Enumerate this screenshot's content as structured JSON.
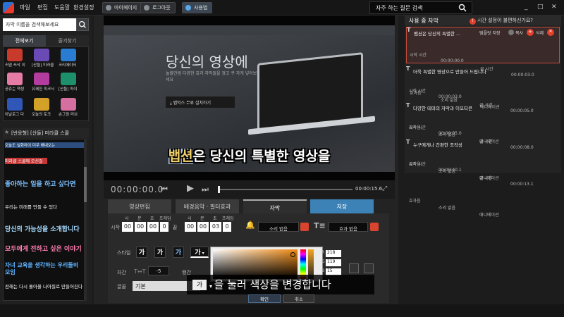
{
  "menubar": {
    "items": [
      "파일",
      "편집",
      "도움말",
      "환경설정"
    ],
    "buttons": {
      "mypage": "마이페이지",
      "logout": "로그아웃",
      "usage": "사용법"
    },
    "faq_label": "자주 하는 질문 검색",
    "window_controls": [
      "_",
      "□",
      "✕"
    ]
  },
  "left": {
    "search_placeholder": "자막 이름을 검색해보세요",
    "tabs": [
      "전체보기",
      "즐겨찾기"
    ],
    "grid": [
      {
        "caption": "귀엽 쓰삭 이",
        "badge": "반응형",
        "color": "#c83b2c"
      },
      {
        "caption": "[산들] 미라클",
        "badge": "반응형",
        "color": "#6a4bb6"
      },
      {
        "caption": "크리에이터",
        "badge": "반응형",
        "color": "#2a7cd1"
      },
      {
        "caption": "공쥬는 책생",
        "badge": "반응형",
        "color": "#e57ca5"
      },
      {
        "caption": "유쾌한 피크닉",
        "badge": "반응형",
        "color": "#b43c9e"
      },
      {
        "caption": "[산들] 마이",
        "badge": "반응형",
        "color": "#1e8f6b"
      },
      {
        "caption": "아날로그 다",
        "badge": "반응형",
        "color": "#3056b8"
      },
      {
        "caption": "오늘의 토크",
        "badge": "반응형",
        "color": "#d3a127"
      },
      {
        "caption": "손그림 러브",
        "badge": "반응형",
        "color": "#d46fa0"
      }
    ],
    "style_title": "[반응형] [산들] 미라클 스쿨",
    "style_samples": [
      "오늘도 실화라이 더우 해내오는",
      "미라클 스쿨에 오신걸",
      "좋아하는 일을 하고 싶다면",
      "우리는 미래를 만들 수 있다",
      "당신의 가능성을 소개합니다",
      "모두에게 전하고 싶은 이야기",
      "자녀 교육을 생각하는 우리들의 모임",
      "전해는 다시 돌아올 나아질로 만들어진다"
    ]
  },
  "video": {
    "hero_title": "당신의 영상에",
    "hero_sub": "놀랄만큼 다양한 효과 자막들을 경고 쿠 과게 넣어보세요",
    "download_label": "뱁믹스 무료 설치하기",
    "subtitle_highlight": "뱁션",
    "subtitle_rest": "은 당신의 특별한 영상을",
    "time_current": "00:00:00.0",
    "time_total": "00:00:15.6"
  },
  "center_tabs": [
    "영상편집",
    "배경음악 · 필터효과",
    "자막",
    "저장"
  ],
  "editor": {
    "start_label": "시작",
    "end_label": "끝",
    "unit_labels": [
      "시",
      "분",
      "초",
      "프레임"
    ],
    "start_fields": [
      "00",
      "00",
      "00",
      "0"
    ],
    "end_fields": [
      "00",
      "00",
      "03",
      "0"
    ],
    "sound_select": "소리 없음",
    "effect_select": "효과 없음",
    "style_label": "스타일",
    "style_buttons": [
      "가",
      "가",
      "가",
      "가"
    ],
    "spacing_label": "자간",
    "spacing_value": "-5",
    "line_label": "행간",
    "font_label": "글꼴",
    "font_value": "기본",
    "rgb": {
      "r": "218",
      "g": "119",
      "b": "15"
    },
    "ok_label": "확인",
    "cancel_label": "취소"
  },
  "tooltip": {
    "swatch": "가",
    "text": "을 눌러 색상을 변경합니다"
  },
  "right": {
    "title": "사용 중 자막",
    "question": "시간 설정이 불편하신가요?",
    "cards": [
      {
        "title": "뱁션은 당신의 특별한 ...",
        "template_btn": "템플릿 저장",
        "copy": "복사",
        "delete": "삭제",
        "start": "00:00:00.0",
        "end": "00:00:03.0",
        "effect": "소리 없음",
        "anim": "애니메이션"
      },
      {
        "title": "더욱 특별한 영상으로 만들어 드립니다",
        "start": "00:00:03.0",
        "end": "00:00:05.0",
        "effect": "소리 없음",
        "anim": "애니메이션"
      },
      {
        "title": "다양한 테마의 자막과 이모티콘",
        "start": "00:00:05.0",
        "end": "00:00:08.0",
        "effect": "소리 없음",
        "anim": "애니메이션"
      },
      {
        "title": "누구에게나 간편한 조작성",
        "start": "00:00:10.1",
        "end": "00:00:13.1",
        "effect": "소리 없음",
        "anim": "애니메이션"
      }
    ],
    "labels": {
      "start": "시작 시간",
      "end": "끝 시간",
      "effect": "효과음"
    }
  }
}
